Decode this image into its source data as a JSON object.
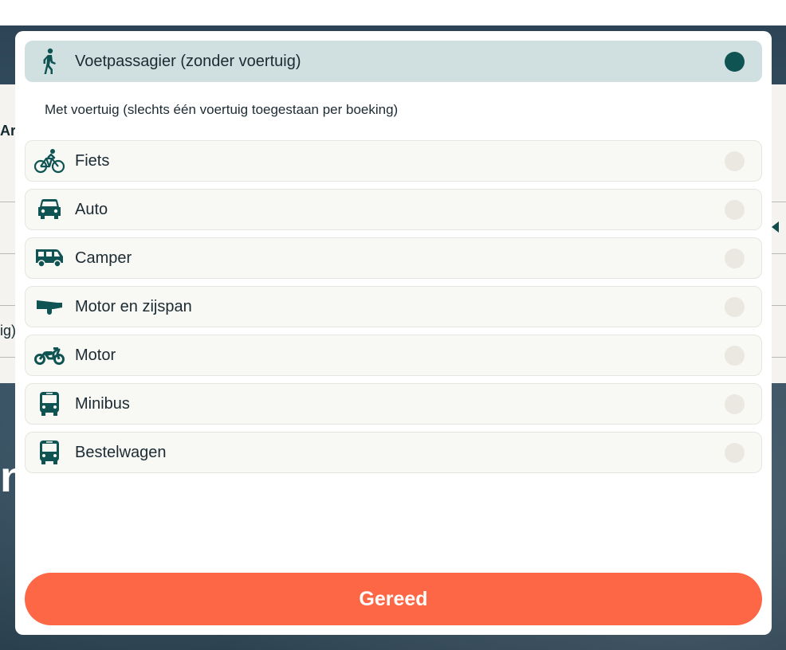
{
  "background": {
    "fragment_ar": "Ar",
    "fragment_ig": "ig)",
    "fragment_n": "n"
  },
  "modal": {
    "foot_passenger": {
      "label": "Voetpassagier (zonder voertuig)",
      "icon": "pedestrian-icon",
      "selected": true
    },
    "vehicle_heading": "Met voertuig (slechts één voertuig toegestaan per boeking)",
    "vehicles": [
      {
        "label": "Fiets",
        "icon": "bicycle-icon",
        "selected": false
      },
      {
        "label": "Auto",
        "icon": "car-icon",
        "selected": false
      },
      {
        "label": "Camper",
        "icon": "camper-icon",
        "selected": false
      },
      {
        "label": "Motor en zijspan",
        "icon": "motorcycle-sidecar-icon",
        "selected": false
      },
      {
        "label": "Motor",
        "icon": "motorcycle-icon",
        "selected": false
      },
      {
        "label": "Minibus",
        "icon": "minibus-icon",
        "selected": false
      },
      {
        "label": "Bestelwagen",
        "icon": "van-icon",
        "selected": false
      }
    ],
    "done_label": "Gereed"
  },
  "colors": {
    "accent_teal": "#0f5452",
    "selected_bg": "#d0e0e0",
    "button_orange": "#fe6746"
  }
}
